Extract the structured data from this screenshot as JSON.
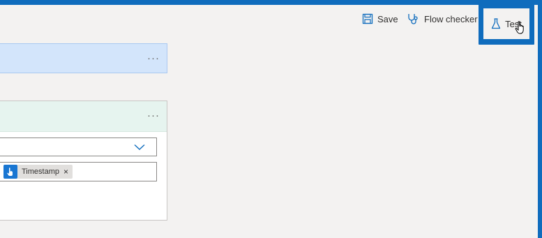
{
  "toolbar": {
    "save_label": "Save",
    "flow_checker_label": "Flow checker",
    "test_label": "Test"
  },
  "cards": [
    {
      "more_label": "···"
    },
    {
      "more_label": "···"
    }
  ],
  "token": {
    "label": "Timestamp",
    "remove_label": "×"
  },
  "colors": {
    "accent": "#0f6cbd",
    "card_blue": "#d3e5fb",
    "card_green": "#e6f4ef"
  }
}
